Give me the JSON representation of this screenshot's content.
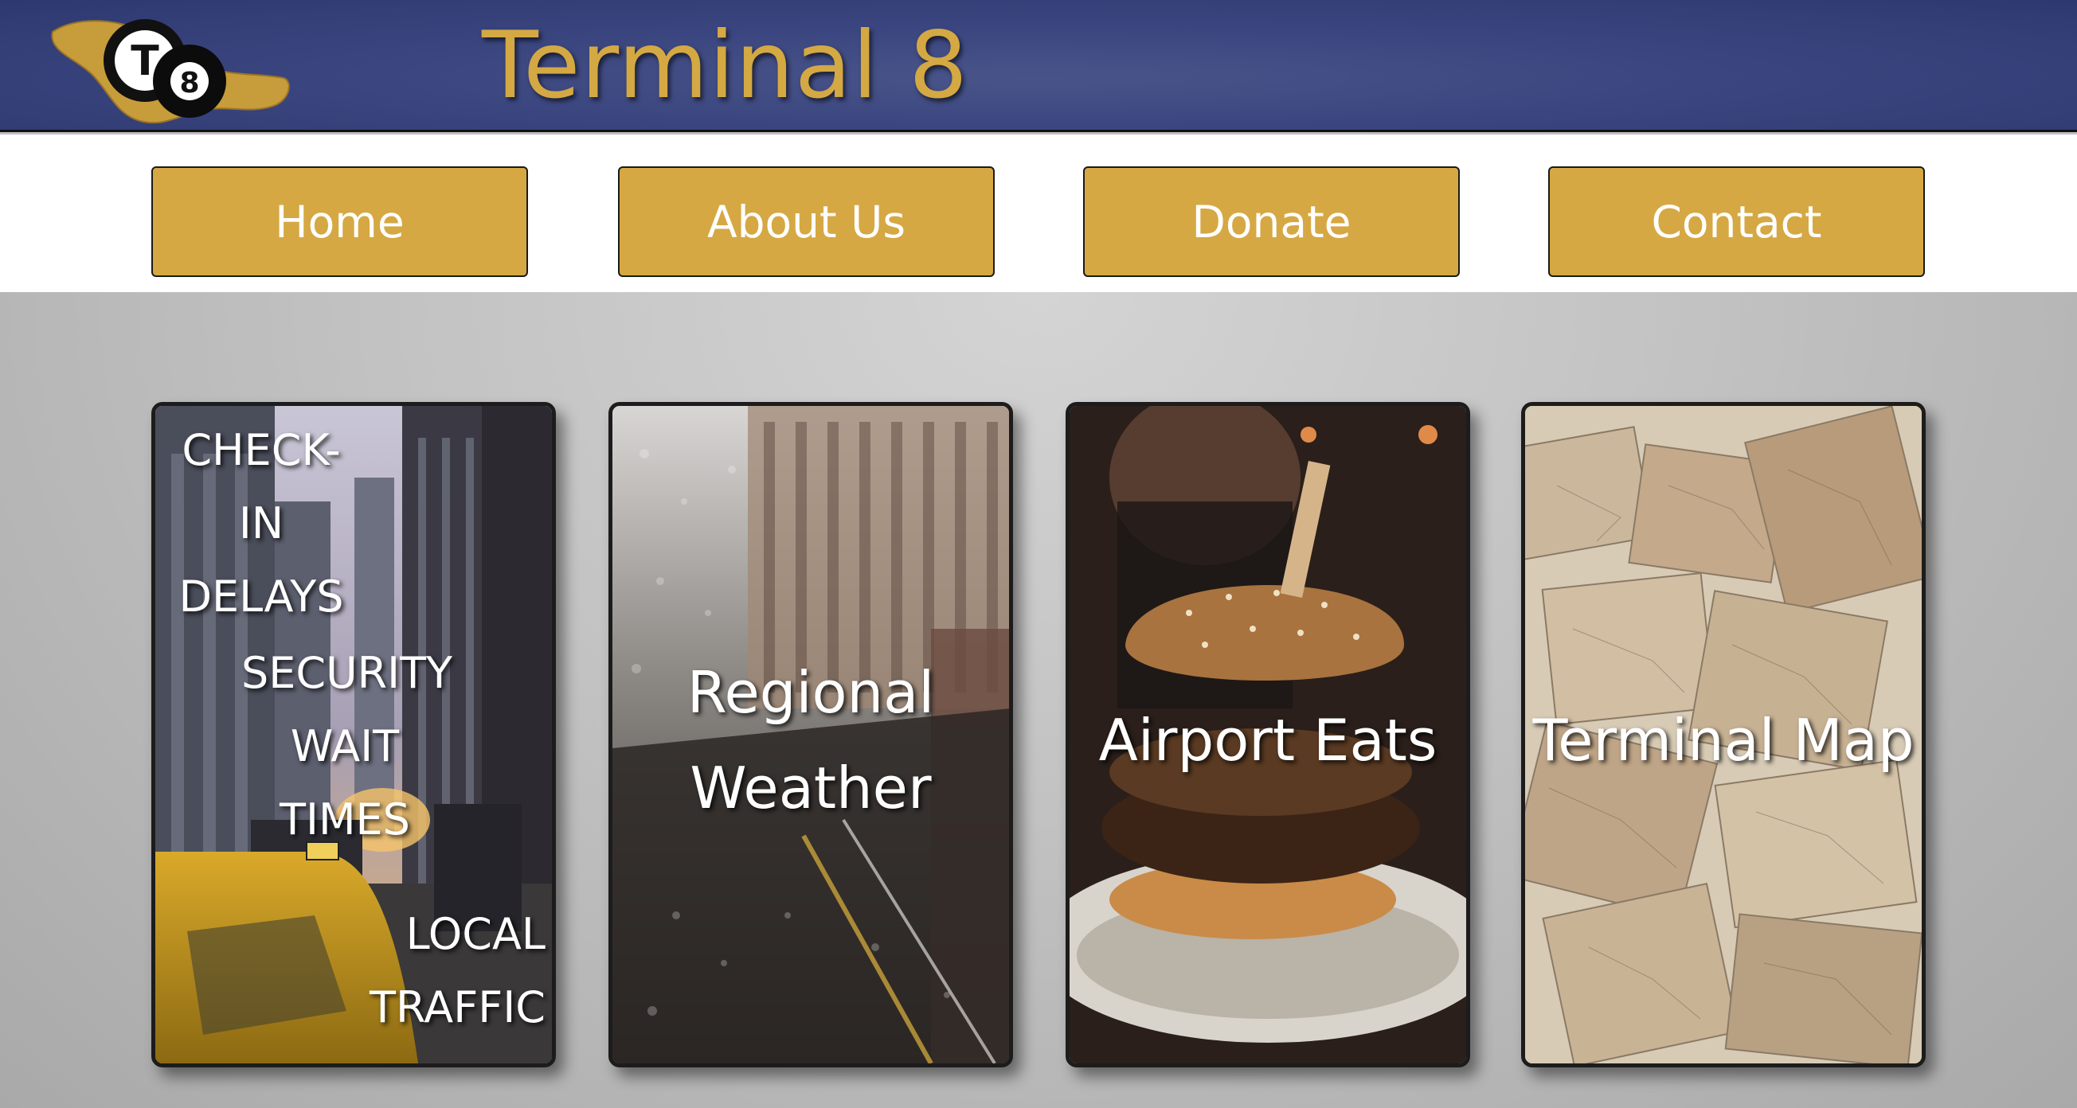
{
  "header": {
    "logo_text": "T8",
    "title": "Terminal 8"
  },
  "nav": {
    "items": [
      "Home",
      "About Us",
      "Donate",
      "Contact"
    ]
  },
  "cards": {
    "checkin": "CHECK-IN DELAYS",
    "security": "SECURITY WAIT TIMES",
    "traffic": "LOCAL TRAFFIC",
    "weather": "Regional Weather",
    "eats": "Airport Eats",
    "map": "Terminal Map"
  },
  "colors": {
    "header_bg": "#3b4680",
    "accent_gold": "#d6a843",
    "nav_bg": "#ffffff",
    "main_bg": "#bfbfbf"
  }
}
